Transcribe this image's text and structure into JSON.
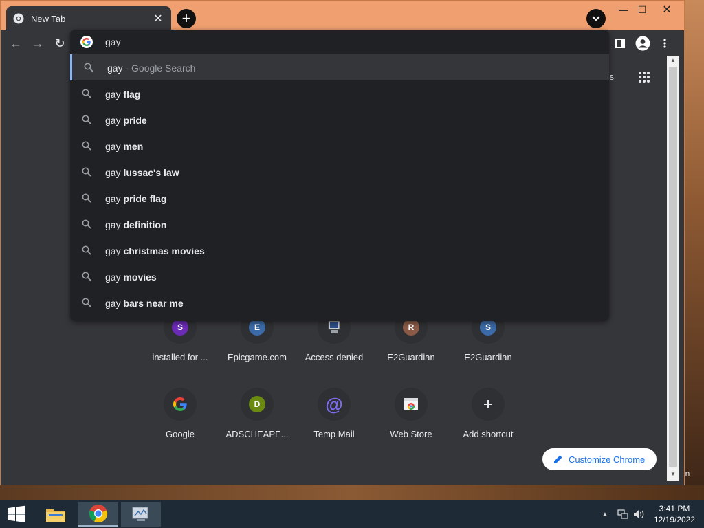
{
  "browser": {
    "tab_title": "New Tab",
    "tab_close": "✕",
    "new_tab_symbol": "+",
    "window_controls": {
      "minimize": "—",
      "maximize": "☐",
      "close": "✕"
    }
  },
  "toolbar": {
    "back": "←",
    "forward": "→",
    "reload": "↻"
  },
  "omnibox": {
    "query": "gay",
    "suggestions": [
      {
        "prefix": "gay",
        "bold": "",
        "hint": " - Google Search",
        "selected": true
      },
      {
        "prefix": "gay ",
        "bold": "flag",
        "hint": ""
      },
      {
        "prefix": "gay ",
        "bold": "pride",
        "hint": ""
      },
      {
        "prefix": "gay ",
        "bold": "men",
        "hint": ""
      },
      {
        "prefix": "gay ",
        "bold": "lussac's law",
        "hint": ""
      },
      {
        "prefix": "gay ",
        "bold": "pride flag",
        "hint": ""
      },
      {
        "prefix": "gay ",
        "bold": "definition",
        "hint": ""
      },
      {
        "prefix": "gay ",
        "bold": "christmas movies",
        "hint": ""
      },
      {
        "prefix": "gay ",
        "bold": "movies",
        "hint": ""
      },
      {
        "prefix": "gay ",
        "bold": "bars near me",
        "hint": ""
      }
    ]
  },
  "ntp": {
    "images_link": "ges",
    "shortcuts_row1": [
      {
        "label": "installed for ...",
        "letter": "S",
        "color": "#6b2bb5"
      },
      {
        "label": "Epicgame.com",
        "letter": "E",
        "color": "#3b6aa8"
      },
      {
        "label": "Access denied",
        "letter": "",
        "color": ""
      },
      {
        "label": "E2Guardian",
        "letter": "R",
        "color": "#8a5a46"
      },
      {
        "label": "E2Guardian",
        "letter": "S",
        "color": "#3b6aa8"
      }
    ],
    "shortcuts_row2": [
      {
        "label": "Google",
        "icon": "google-icon"
      },
      {
        "label": "ADSCHEAPE...",
        "letter": "D",
        "color": "#6b8a12"
      },
      {
        "label": "Temp Mail",
        "icon": "at-icon"
      },
      {
        "label": "Web Store",
        "icon": "web-store-icon"
      },
      {
        "label": "Add shortcut",
        "icon": "plus-icon"
      }
    ],
    "customize_label": "Customize Chrome"
  },
  "desktop": {
    "peek_text": "in"
  },
  "taskbar": {
    "time": "3:41 PM",
    "date": "12/19/2022"
  }
}
